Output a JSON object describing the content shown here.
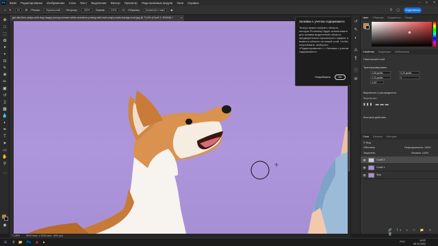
{
  "menubar": {
    "items": [
      "Файл",
      "Редактирование",
      "Изображение",
      "Слои",
      "Текст",
      "Выделение",
      "Фильтр",
      "Просмотр",
      "Подключаемые модули",
      "Окно",
      "Справка"
    ]
  },
  "options": {
    "size_value": "19",
    "mode_label": "Режим:",
    "mode_value": "Нормальный",
    "opacity_label": "Непрозр.:",
    "opacity_value": "100%",
    "flow_label": "Нажим:",
    "flow_value": "100%",
    "sample_label": "Образец:",
    "sample_value": "Активный и ниже",
    "share_label": "Поделиться"
  },
  "document": {
    "tab_title": "girl-sits-floor-plays-with-dog-happy-young-woman-white-sneakers-posing-with-ball-corgi-purple-background.jpg @ 71,5% (Слой 2, RGB/8) *"
  },
  "status": {
    "zoom": "71,48%",
    "dims": "5000 пикс. x 3334 пикс. (300 ppi)"
  },
  "tooltip": {
    "title": "Заливка с учетом содержимого",
    "body": "Теперь можно выбрать область, которую Photoshop будет использовать для заливки выделенной области, предварительно просмотреть эффект и вывести область на новый слой. Чтобы попробовать, выберите «Редактирование» > «Заливка с учетом содержимого».",
    "try_label": "Попробовать",
    "ok_label": "OK"
  },
  "color_panel": {
    "tabs": [
      "Цвет",
      "Образцы",
      "Градиенты",
      "Узоры"
    ],
    "fg": "#e87b1e",
    "bg": "#1a1a1a"
  },
  "properties": {
    "tabs": [
      "Свойства",
      "Коррекция",
      "Библиотеки"
    ],
    "layer_kind": "Пиксельный слой",
    "transform_label": "Трансформировать",
    "w_value": "4,58 дюйм.",
    "h_value": "2,33 дюйм.",
    "x_value": "5,25 дюйм.",
    "y_value": "0",
    "angle_value": "0,00°",
    "align_label": "Выровнять и распределить",
    "align_sub": "Выровнять:",
    "quick_label": "Быстрые действия"
  },
  "layers": {
    "tabs": [
      "Слои",
      "Каналы",
      "Контуры"
    ],
    "filter_label": "Вид",
    "blend_mode": "Обычные",
    "opacity_label": "Непрозрачность:",
    "opacity_value": "100%",
    "lock_label": "Закрепить:",
    "fill_label": "Заливка:",
    "fill_value": "100%",
    "items": [
      {
        "name": "Слой 2"
      },
      {
        "name": "Слой 1"
      },
      {
        "name": "Фон"
      }
    ]
  },
  "taskbar": {
    "lang": "РУС",
    "time": "14:22",
    "date": "08.10.2024"
  }
}
